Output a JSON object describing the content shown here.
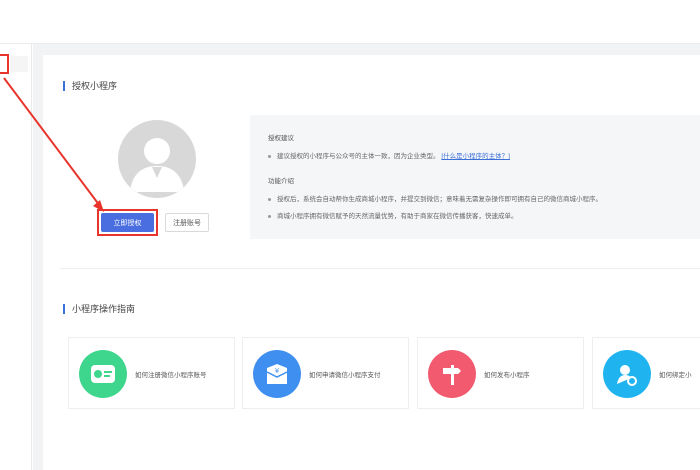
{
  "section_authorize": {
    "title": "授权小程序"
  },
  "buttons": {
    "authorize_now": "立即授权",
    "register": "注册账号"
  },
  "info": {
    "suggestion_title": "授权建议",
    "suggestion_line": "建议授权的小程序与公众号的主体一致，因为企业类型。",
    "suggestion_link": "[什么是小程序的主体？]",
    "feature_title": "功能介绍",
    "feature_line1": "授权后，系统会自动帮你生成商城小程序，并提交到微信；意味着无需复杂操作即可拥有自己的微信商城小程序。",
    "feature_line2": "商城小程序拥有微信赋予的天然流量优势，有助于商家在微信传播获客，快速成单。"
  },
  "section_guide": {
    "title": "小程序操作指南"
  },
  "guides": [
    {
      "label": "如何注册微信小程序账号",
      "icon": "id-card-icon",
      "color": "#3dd68c"
    },
    {
      "label": "如何申请微信小程序支付",
      "icon": "wallet-icon",
      "color": "#3f8ff0"
    },
    {
      "label": "如何发布小程序",
      "icon": "signpost-icon",
      "color": "#f25a6f"
    },
    {
      "label": "如何绑定小",
      "icon": "user-link-icon",
      "color": "#1fb4f0"
    }
  ],
  "colors": {
    "accent": "#4a6ee0",
    "highlight": "#e8352c"
  }
}
